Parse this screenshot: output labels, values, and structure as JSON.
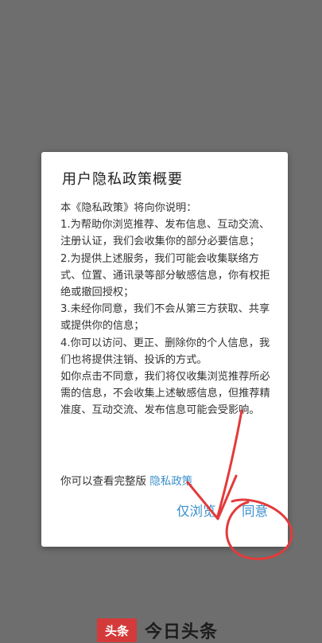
{
  "dialog": {
    "title": "用户隐私政策概要",
    "paragraphs": [
      "本《隐私政策》将向你说明：",
      "1.为帮助你浏览推荐、发布信息、互动交流、注册认证，我们会收集你的部分必要信息；",
      "2.为提供上述服务，我们可能会收集联络方式、位置、通讯录等部分敏感信息，你有权拒绝或撤回授权；",
      "3.未经你同意，我们不会从第三方获取、共享或提供你的信息；",
      "4.你可以访问、更正、删除你的个人信息，我们也将提供注销、投诉的方式。",
      "如你点击不同意，我们将仅收集浏览推荐所必需的信息，不会收集上述敏感信息，但推荐精准度、互动交流、发布信息可能会受影响。"
    ],
    "link_prefix": "你可以查看完整版",
    "link_text": "隐私政策",
    "browse_only_button": "仅浏览",
    "agree_button": "同意",
    "accent_color": "#3a8fcc"
  },
  "annotation": {
    "color": "#e23b3b",
    "shapes": [
      "arrow",
      "circle"
    ]
  },
  "footer": {
    "logo_badge": "头条",
    "app_name": "今日头条"
  }
}
